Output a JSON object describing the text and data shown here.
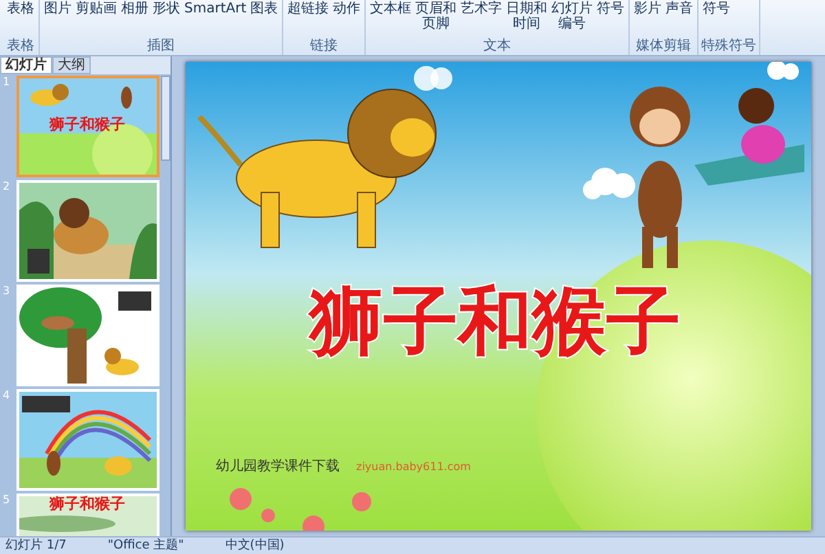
{
  "ribbon": {
    "groups": [
      {
        "label": "表格",
        "commands": [
          "表格"
        ]
      },
      {
        "label": "插图",
        "commands": [
          "图片",
          "剪贴画",
          "相册",
          "形状",
          "SmartArt",
          "图表"
        ]
      },
      {
        "label": "链接",
        "commands": [
          "超链接",
          "动作"
        ]
      },
      {
        "label": "文本",
        "commands": [
          "文本框",
          "页眉和页脚",
          "艺术字",
          "日期和时间",
          "幻灯片编号",
          "符号"
        ]
      },
      {
        "label": "媒体剪辑",
        "commands": [
          "影片",
          "声音"
        ]
      },
      {
        "label": "特殊符号",
        "commands": [
          "符号"
        ]
      }
    ]
  },
  "panel": {
    "tabs": [
      {
        "label": "幻灯片",
        "selected": true
      },
      {
        "label": "大纲",
        "selected": false
      }
    ],
    "slides": [
      {
        "number": "1",
        "selected": true,
        "kind": "cover",
        "title": "狮子和猴子"
      },
      {
        "number": "2",
        "selected": false,
        "kind": "lion"
      },
      {
        "number": "3",
        "selected": false,
        "kind": "tree"
      },
      {
        "number": "4",
        "selected": false,
        "kind": "rainbow"
      },
      {
        "number": "5",
        "selected": false,
        "kind": "title",
        "title": "狮子和猴子"
      }
    ]
  },
  "slide": {
    "title": "狮子和猴子",
    "footer": "幼儿园教学课件下载",
    "footer_link": "ziyuan.baby611.com"
  },
  "status_bar": {
    "slide": "幻灯片 1/7",
    "theme": "\"Office 主题\"",
    "language": "中文(中国)"
  }
}
